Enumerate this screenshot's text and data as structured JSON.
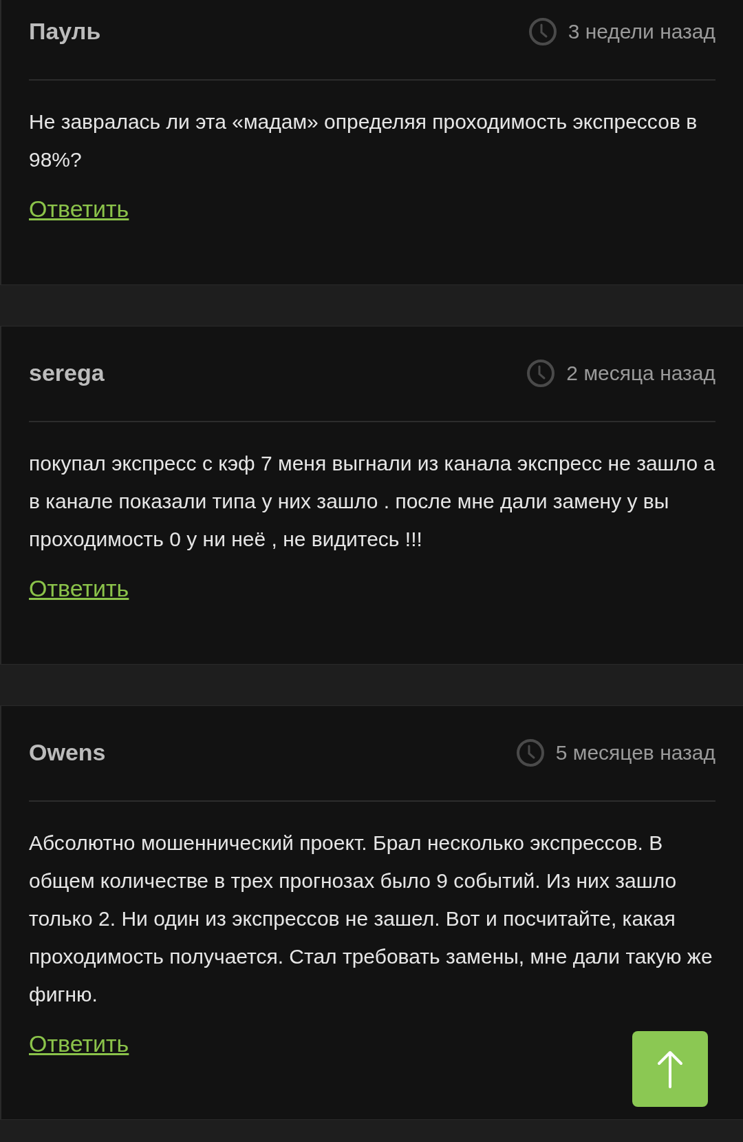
{
  "comments": [
    {
      "author": "Пауль",
      "time": "3 недели назад",
      "text": "Не завралась ли эта «мадам» определяя проходимость экспрессов в 98%?",
      "reply": "Ответить"
    },
    {
      "author": "serega",
      "time": "2 месяца назад",
      "text": "покупал экспресс с кэф 7 меня выгнали из канала экспресс не зашло а в канале показали типа у них зашло . после мне дали замену у вы проходимость 0 у ни неё , не видитесь !!!",
      "reply": "Ответить"
    },
    {
      "author": "Owens",
      "time": "5 месяцев назад",
      "text": "Абсолютно мошеннический проект. Брал несколько экспрессов. В общем количестве в трех прогнозах было 9 событий. Из них зашло только 2. Ни один из экспрессов не зашел. Вот и посчитайте, какая проходимость получается. Стал требовать замены, мне дали такую же фигню.",
      "reply": "Ответить"
    }
  ]
}
